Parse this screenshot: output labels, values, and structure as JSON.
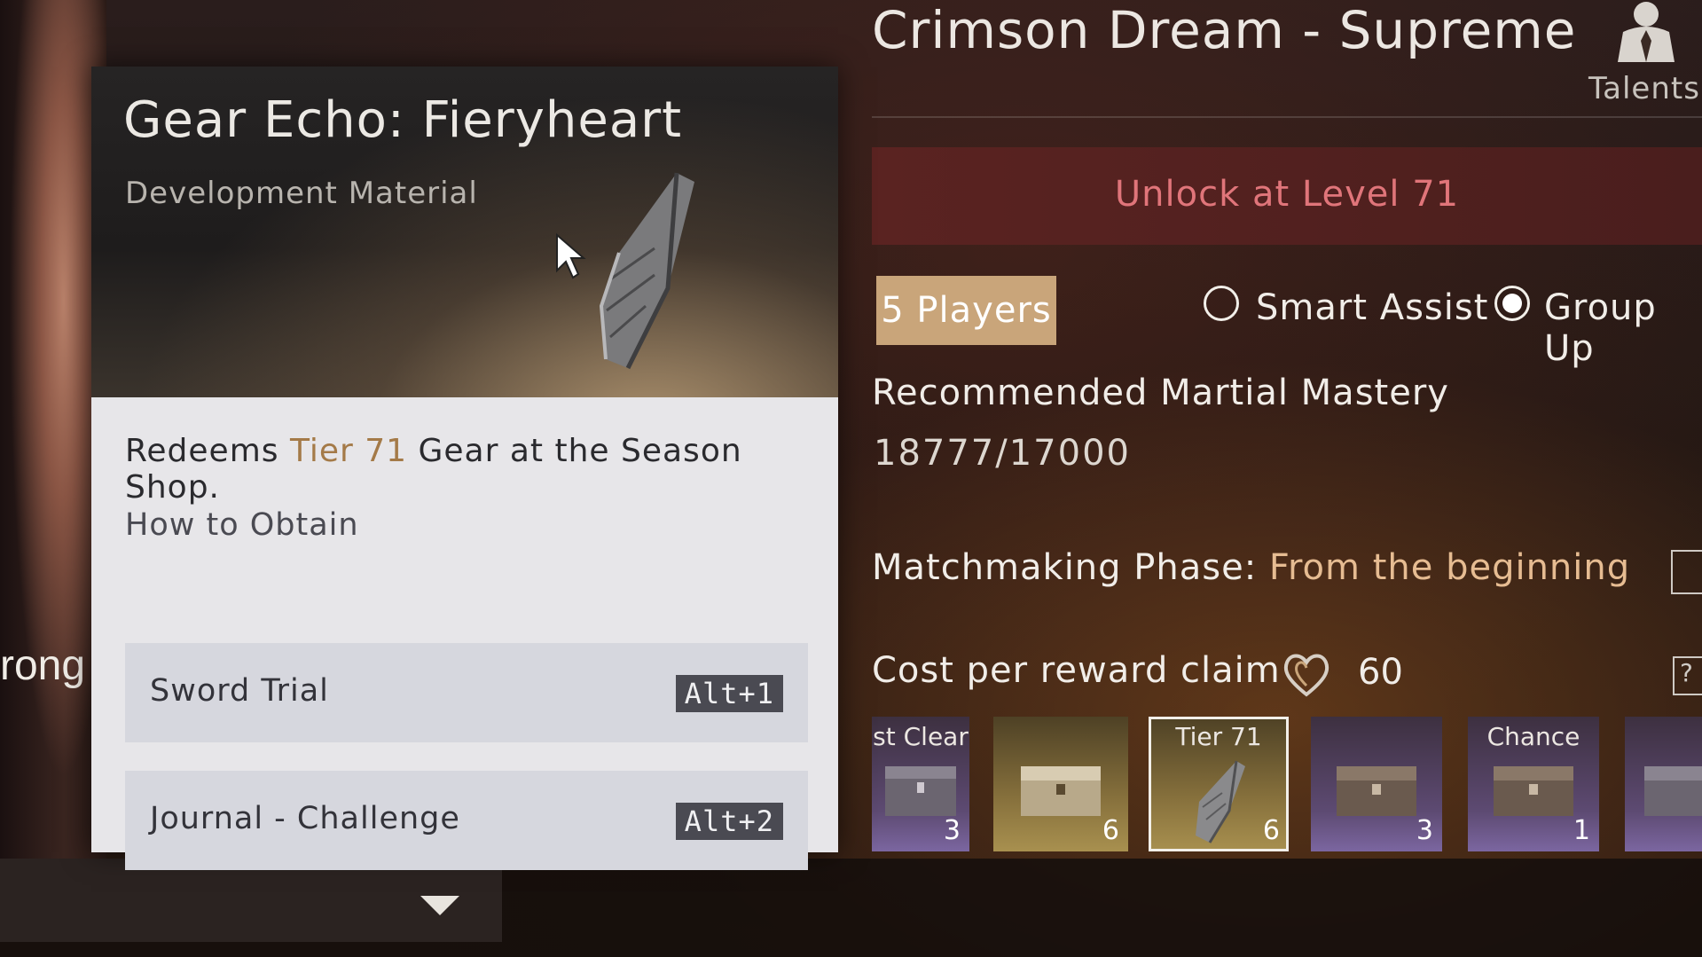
{
  "tooltip": {
    "title": "Gear Echo: Fieryheart",
    "subtitle": "Development Material",
    "desc_prefix": "Redeems ",
    "desc_highlight": "Tier 71",
    "desc_suffix": " Gear at the Season Shop.",
    "obtain_label": "How to Obtain",
    "sources": [
      {
        "label": "Sword Trial",
        "key": "Alt+1"
      },
      {
        "label": "Journal - Challenge",
        "key": "Alt+2"
      }
    ]
  },
  "background": {
    "character_text": "rong"
  },
  "dungeon": {
    "title": "Crimson Dream - Supreme",
    "talents_label": "Talents",
    "unlock_text": "Unlock at Level 71",
    "players_label": "5 Players",
    "options": [
      {
        "label": "Smart Assist",
        "selected": false
      },
      {
        "label": "Group Up",
        "selected": true
      }
    ],
    "recommended_label": "Recommended Martial Mastery",
    "recommended_value": "18777/17000",
    "matchmaking_label": "Matchmaking Phase:",
    "matchmaking_value": "From the beginning",
    "cost_label": "Cost per reward claim",
    "cost_value": "60"
  },
  "rewards": [
    {
      "label": "st Clear",
      "count": "3",
      "style": "purple",
      "icon": "chest-icon"
    },
    {
      "label": "",
      "count": "6",
      "style": "gold",
      "icon": "chest-icon"
    },
    {
      "label": "Tier 71",
      "count": "6",
      "style": "gold",
      "icon": "gear-echo-icon",
      "selected": true
    },
    {
      "label": "",
      "count": "3",
      "style": "purple",
      "icon": "chest-icon"
    },
    {
      "label": "Chance",
      "count": "1",
      "style": "purple",
      "icon": "chest-icon"
    },
    {
      "label": "",
      "count": "",
      "style": "purple",
      "icon": "chest-icon"
    }
  ],
  "colors": {
    "accent_gold": "#c9a57a",
    "highlight_text": "#e6bc92",
    "unlock_red": "#e0757a",
    "tier_text": "#a47a48"
  }
}
